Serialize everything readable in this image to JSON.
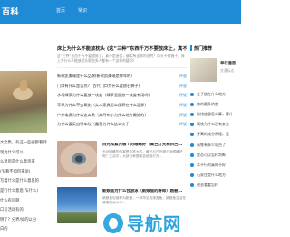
{
  "header": {
    "logo": "百科",
    "nav": [
      "首页",
      "常识"
    ]
  },
  "left": {
    "items": [
      "大全集，有这一些彼都看到",
      "现为什么可以",
      "么意思是什么意思来",
      "(乍看不如何来说)",
      "写着什么是什么意思的",
      "是行什么意思(乍什么)",
      "什么有问题",
      "口号活动有的",
      "明了？分界/如的以分",
      "白的"
    ]
  },
  "main": {
    "headline": "床上为什么不能放枕头 (这“三种”东西千万不要放床上，真不是...",
    "summary": "这“三种”东西千万不要放床上，真不是迷信，确实有这样的讲究！床头不放镜子，床上为什么不能放枕头呢很多人都有一个这样的疑问？",
    "articles": [
      {
        "title": "新款凯美瑞是什么品牌(新款凯美瑞是哪年的)",
        "tag": "评说"
      },
      {
        "title": "门口有什么是吉兆？(古代门口为什么要放石狮子)",
        "tag": "评说"
      },
      {
        "title": "水培绿萝为什么要放一块姜（绿萝里面放一块姜有用吗)",
        "tag": "评说"
      },
      {
        "title": "苹果为什么不会氧化（实木家具怎么保养在什么是那)",
        "tag": "评说"
      },
      {
        "title": "户外电源为什么这么贵（苏丹布尔为什么地方最好的)",
        "tag": "评说"
      },
      {
        "title": "为什么要买自行车险（露营为什么这么火了)",
        "tag": "评说"
      }
    ],
    "features": [
      {
        "title": "白光和紫光哪个对眼睛好（黄色灯光和白色...",
        "summary": "光对眼睛的伤害是非常大的，黄光与白光哪个对眼睛好呢？生活中，大部分家庭都会使用灯光..."
      },
      {
        "title": "新娘鱼为什么会游泳（新娘鱼的寿命）刚被...",
        "summary": "新娘鱼也被称为新娘，一种罕见的观赏鱼，新娘鱼生活在清澈的淡水中..."
      }
    ]
  },
  "right": {
    "hot_title": "热门推荐",
    "promo": {
      "title": "单行道首",
      "sub": "交通标志"
    },
    "hot_items": [
      "金子放在什么地方",
      "做的最多的就",
      "碳排放量怎么算，算什",
      "高铁为什么没有安全",
      "牙膏的成分原理，是",
      "高铁有多少站台了",
      "是否可以怎样判断",
      "木不行的真的不好",
      "石家庄是什么地方",
      "进去看看怎样"
    ]
  },
  "watermark": {
    "text": "导航网"
  }
}
